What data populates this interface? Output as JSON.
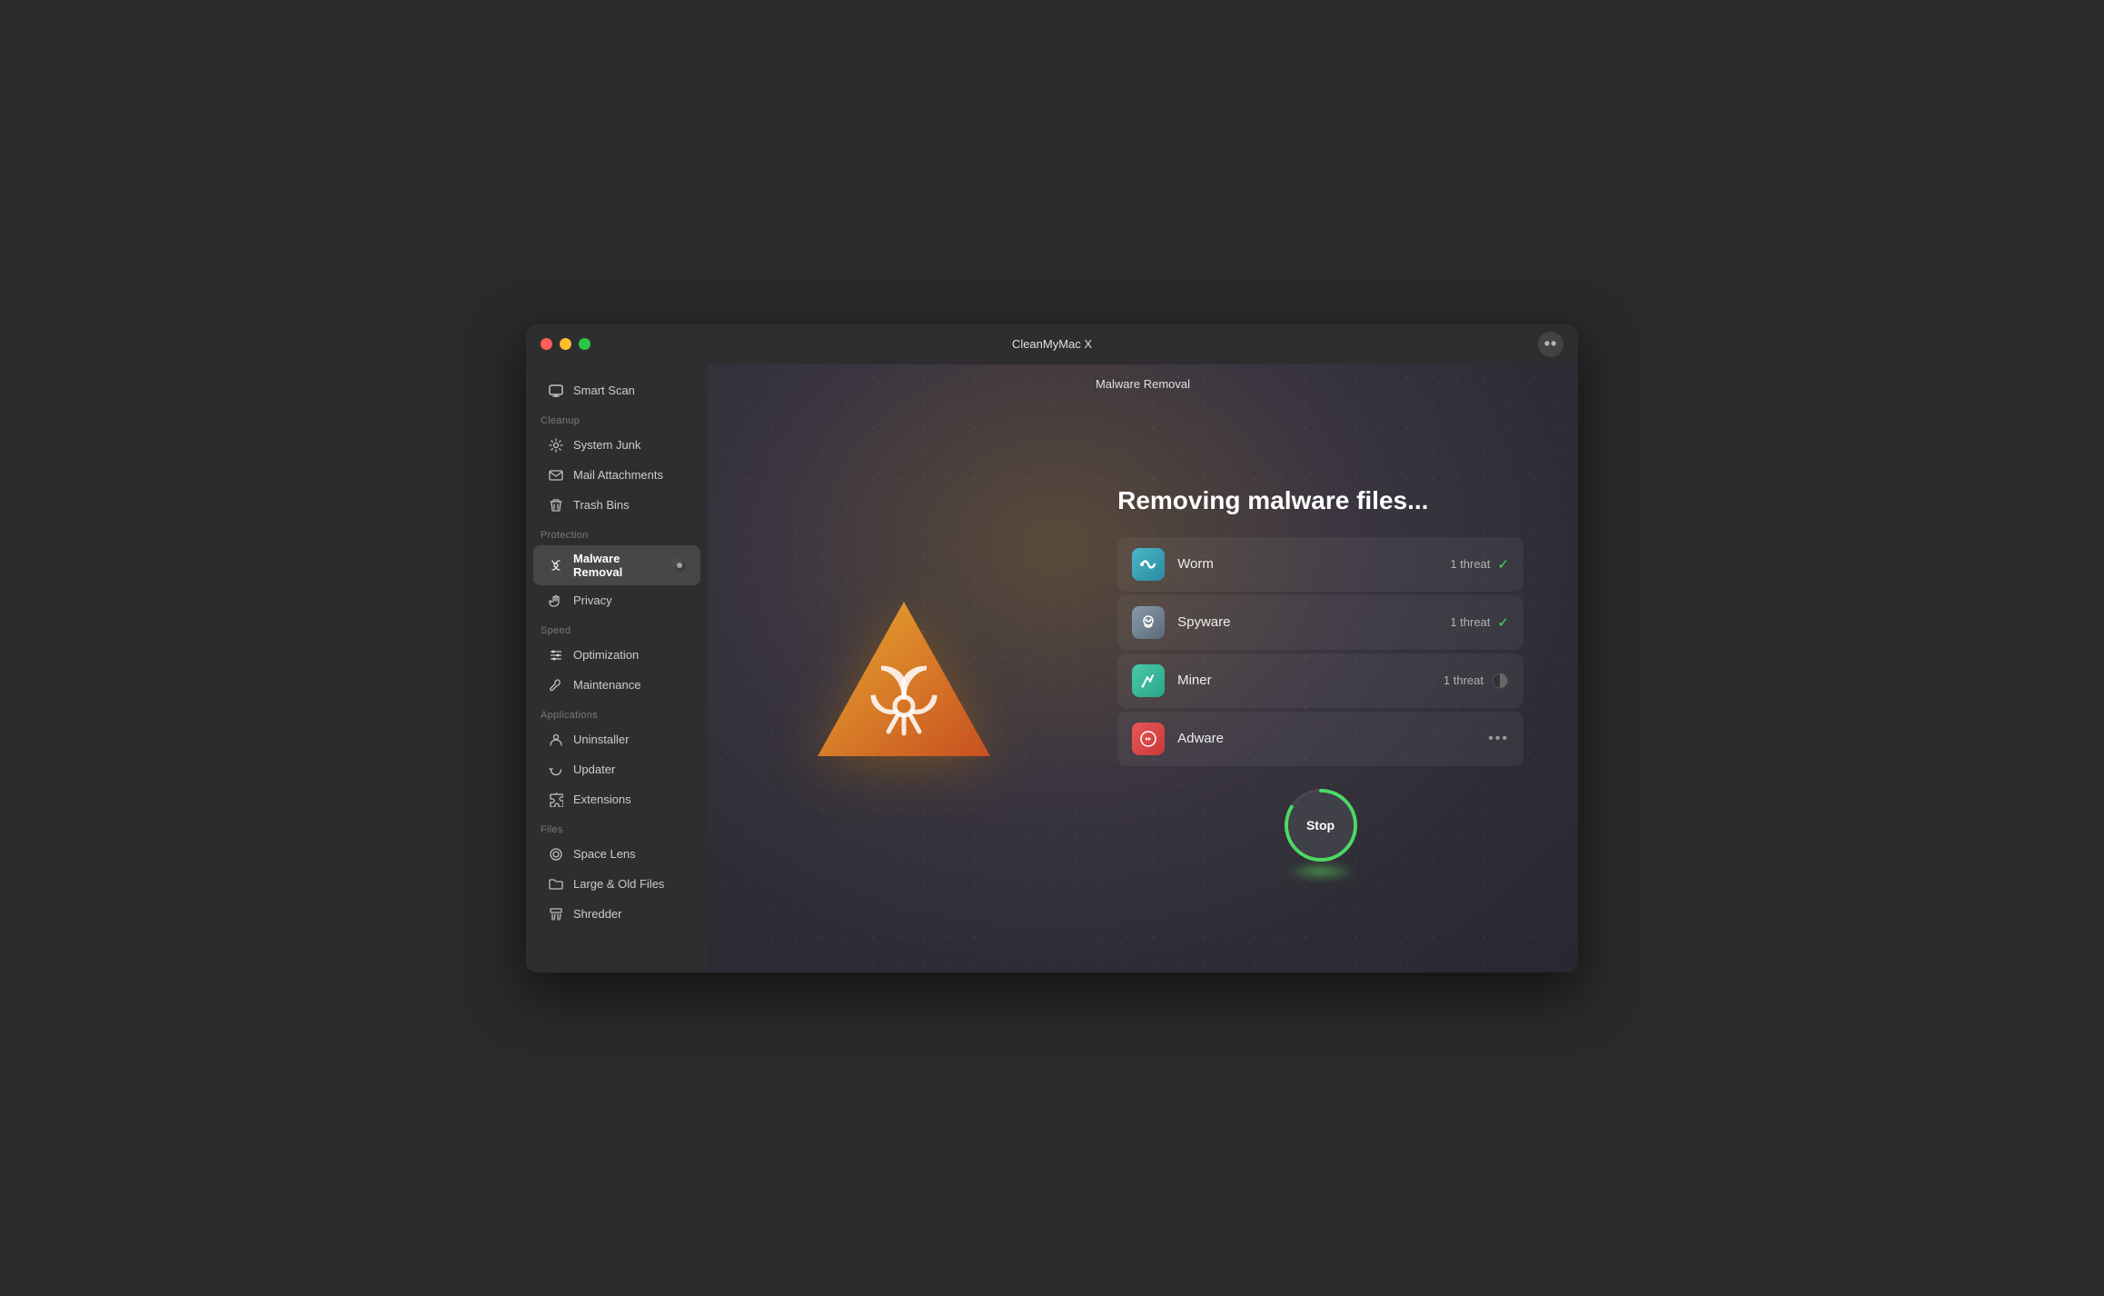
{
  "window": {
    "app_name": "CleanMyMac X",
    "page_title": "Malware Removal",
    "more_icon": "••"
  },
  "sidebar": {
    "top_item": {
      "label": "Smart Scan",
      "icon": "monitor"
    },
    "sections": [
      {
        "label": "Cleanup",
        "items": [
          {
            "id": "system-junk",
            "label": "System Junk",
            "icon": "gear"
          },
          {
            "id": "mail-attachments",
            "label": "Mail Attachments",
            "icon": "envelope"
          },
          {
            "id": "trash-bins",
            "label": "Trash Bins",
            "icon": "trash"
          }
        ]
      },
      {
        "label": "Protection",
        "items": [
          {
            "id": "malware-removal",
            "label": "Malware Removal",
            "icon": "shield",
            "active": true
          },
          {
            "id": "privacy",
            "label": "Privacy",
            "icon": "hand"
          }
        ]
      },
      {
        "label": "Speed",
        "items": [
          {
            "id": "optimization",
            "label": "Optimization",
            "icon": "sliders"
          },
          {
            "id": "maintenance",
            "label": "Maintenance",
            "icon": "wrench"
          }
        ]
      },
      {
        "label": "Applications",
        "items": [
          {
            "id": "uninstaller",
            "label": "Uninstaller",
            "icon": "person"
          },
          {
            "id": "updater",
            "label": "Updater",
            "icon": "refresh"
          },
          {
            "id": "extensions",
            "label": "Extensions",
            "icon": "puzzle"
          }
        ]
      },
      {
        "label": "Files",
        "items": [
          {
            "id": "space-lens",
            "label": "Space Lens",
            "icon": "circle"
          },
          {
            "id": "large-old-files",
            "label": "Large & Old Files",
            "icon": "folder"
          },
          {
            "id": "shredder",
            "label": "Shredder",
            "icon": "shred"
          }
        ]
      }
    ]
  },
  "main": {
    "removing_title": "Removing malware files...",
    "threats": [
      {
        "id": "worm",
        "name": "Worm",
        "count": "1 threat",
        "status": "done"
      },
      {
        "id": "spyware",
        "name": "Spyware",
        "count": "1 threat",
        "status": "done"
      },
      {
        "id": "miner",
        "name": "Miner",
        "count": "1 threat",
        "status": "progress"
      },
      {
        "id": "adware",
        "name": "Adware",
        "count": "",
        "status": "pending"
      }
    ],
    "stop_button_label": "Stop"
  }
}
